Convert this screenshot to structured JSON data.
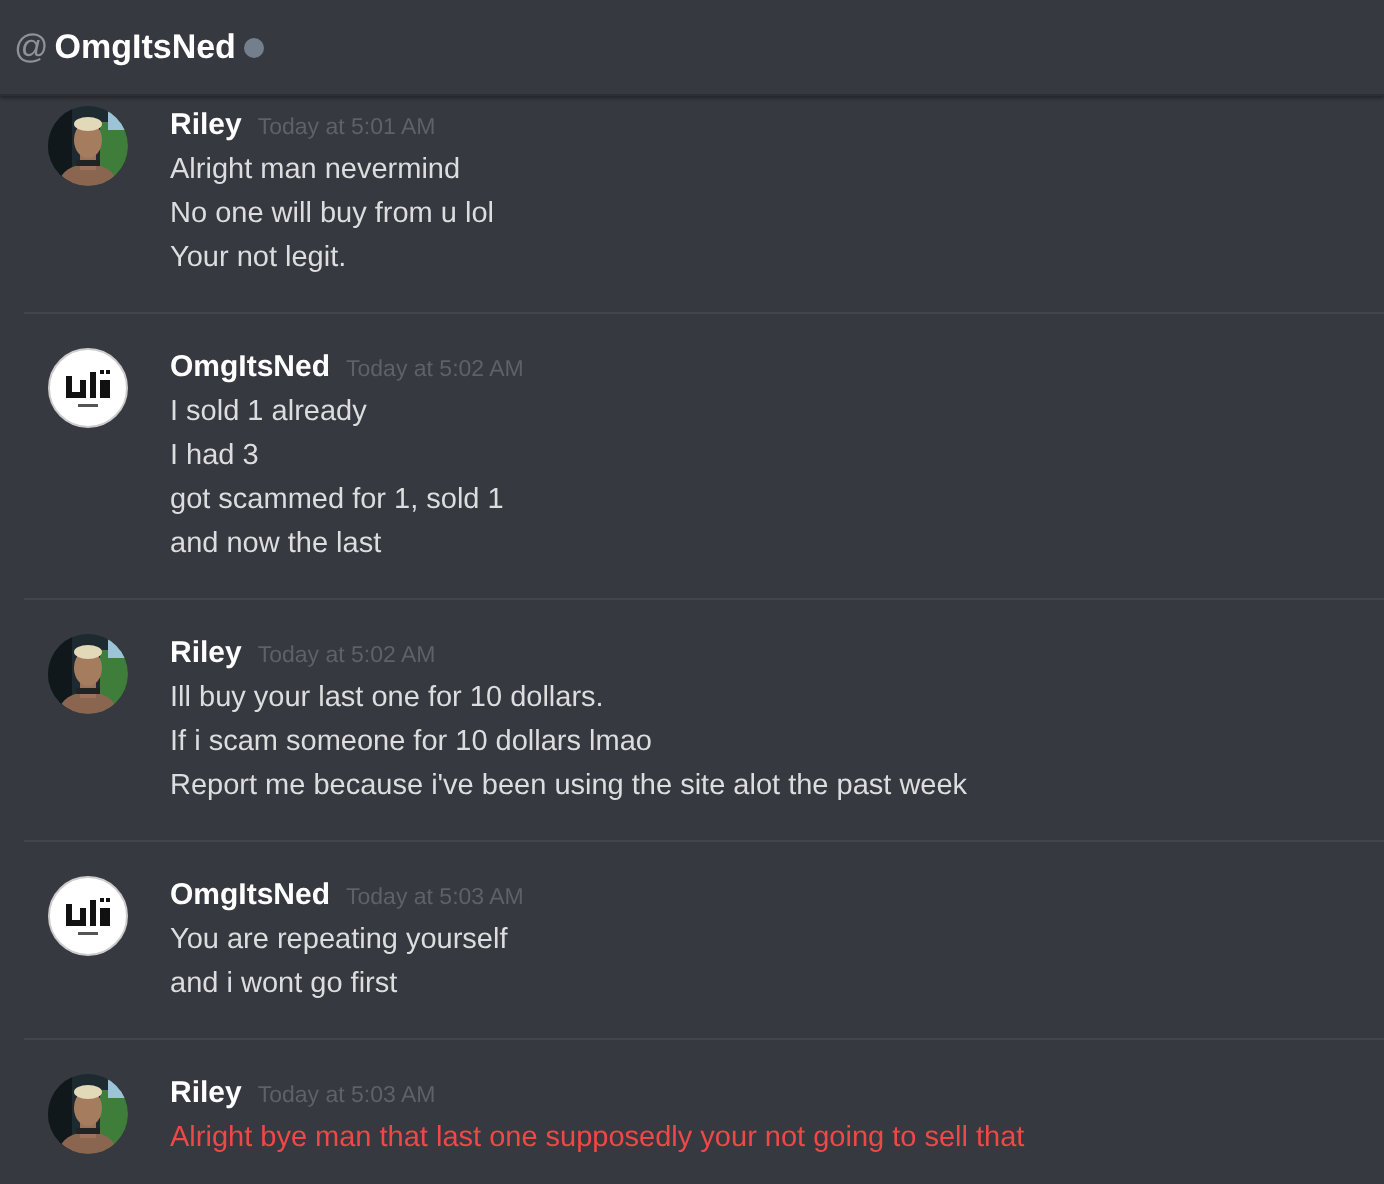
{
  "header": {
    "at_sign": "@",
    "title": "OmgItsNed",
    "online": false
  },
  "messages": [
    {
      "author": "Riley",
      "kind": "picture",
      "time": "Today at 5:01 AM",
      "error": false,
      "lines": [
        "Alright man nevermind",
        "No one will buy from u lol",
        "Your not legit."
      ]
    },
    {
      "author": "OmgItsNed",
      "kind": "logo",
      "time": "Today at 5:02 AM",
      "error": false,
      "lines": [
        "I sold 1 already",
        "I had 3",
        "got scammed for 1, sold 1",
        "and now the last"
      ]
    },
    {
      "author": "Riley",
      "kind": "picture",
      "time": "Today at 5:02 AM",
      "error": false,
      "lines": [
        "Ill buy your last one for 10 dollars.",
        "If i scam someone for 10 dollars lmao",
        "Report me because i've been using the site alot the past week"
      ]
    },
    {
      "author": "OmgItsNed",
      "kind": "logo",
      "time": "Today at 5:03 AM",
      "error": false,
      "lines": [
        "You are repeating yourself",
        "and i wont go first"
      ]
    },
    {
      "author": "Riley",
      "kind": "picture",
      "time": "Today at 5:03 AM",
      "error": true,
      "lines": [
        "Alright bye man that last one supposedly your not going to sell that"
      ]
    }
  ]
}
